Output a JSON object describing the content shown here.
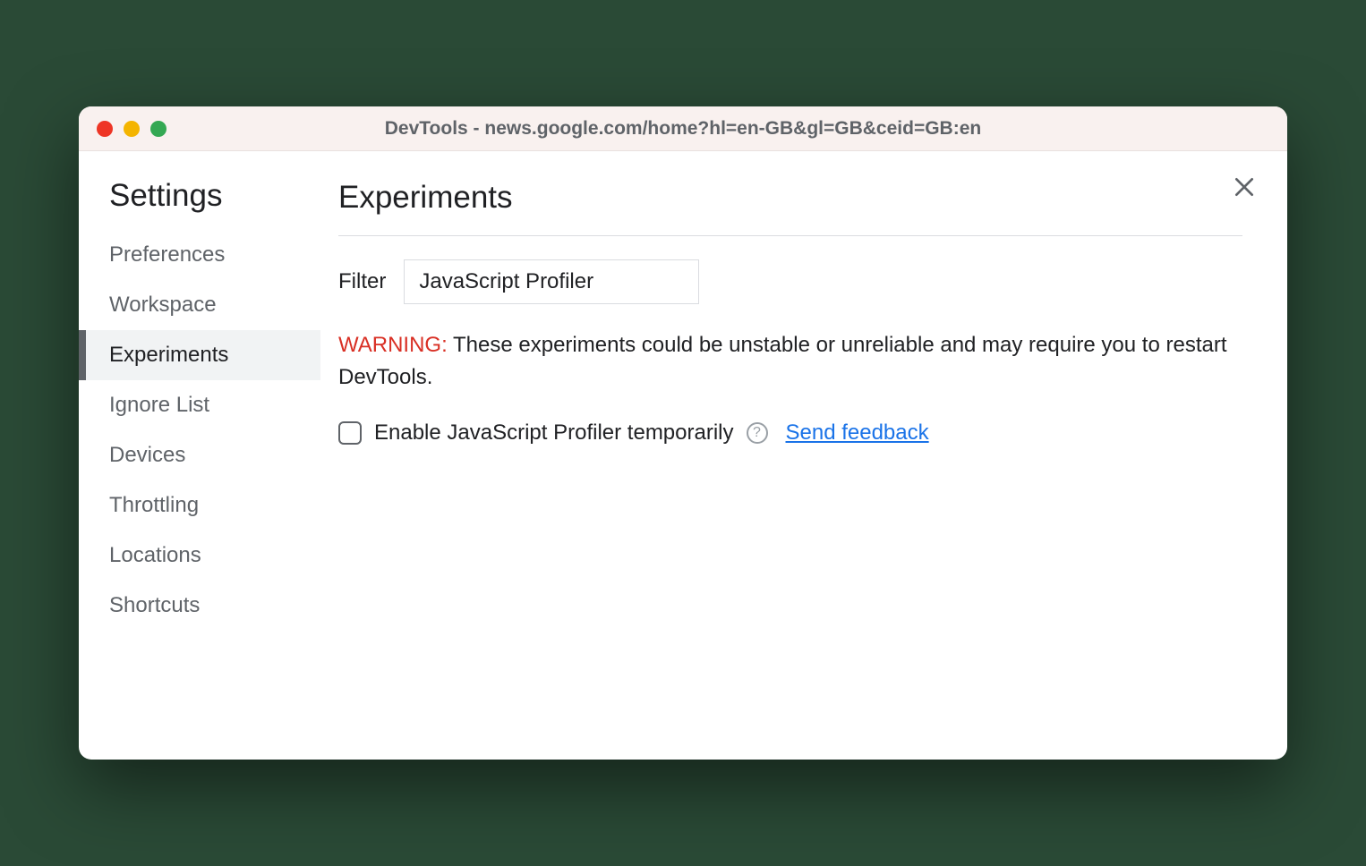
{
  "window": {
    "title": "DevTools - news.google.com/home?hl=en-GB&gl=GB&ceid=GB:en"
  },
  "sidebar": {
    "title": "Settings",
    "items": [
      {
        "label": "Preferences",
        "active": false
      },
      {
        "label": "Workspace",
        "active": false
      },
      {
        "label": "Experiments",
        "active": true
      },
      {
        "label": "Ignore List",
        "active": false
      },
      {
        "label": "Devices",
        "active": false
      },
      {
        "label": "Throttling",
        "active": false
      },
      {
        "label": "Locations",
        "active": false
      },
      {
        "label": "Shortcuts",
        "active": false
      }
    ]
  },
  "main": {
    "title": "Experiments",
    "filter": {
      "label": "Filter",
      "value": "JavaScript Profiler"
    },
    "warning": {
      "prefix": "WARNING:",
      "text": " These experiments could be unstable or unreliable and may require you to restart DevTools."
    },
    "experiment": {
      "label": "Enable JavaScript Profiler temporarily",
      "checked": false,
      "help": "?",
      "feedback": "Send feedback"
    }
  }
}
